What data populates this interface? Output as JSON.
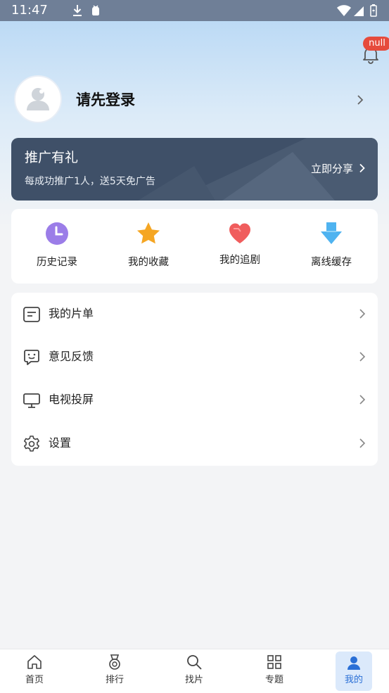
{
  "status_bar": {
    "time": "11:47"
  },
  "notification": {
    "badge": "null"
  },
  "profile": {
    "login_prompt": "请先登录"
  },
  "promo": {
    "title": "推广有礼",
    "subtitle": "每成功推广1人，送5天免广告",
    "action": "立即分享"
  },
  "quick_actions": [
    {
      "label": "历史记录",
      "icon": "clock-icon",
      "color": "#9b7de8"
    },
    {
      "label": "我的收藏",
      "icon": "star-icon",
      "color": "#f5a623"
    },
    {
      "label": "我的追剧",
      "icon": "heart-icon",
      "color": "#f05d5d"
    },
    {
      "label": "离线缓存",
      "icon": "download-arrow-icon",
      "color": "#4fb3f0"
    }
  ],
  "menu": [
    {
      "label": "我的片单",
      "icon": "list-icon"
    },
    {
      "label": "意见反馈",
      "icon": "feedback-icon"
    },
    {
      "label": "电视投屏",
      "icon": "tv-cast-icon"
    },
    {
      "label": "设置",
      "icon": "gear-icon"
    }
  ],
  "tabs": [
    {
      "label": "首页",
      "icon": "home-icon"
    },
    {
      "label": "排行",
      "icon": "medal-icon"
    },
    {
      "label": "找片",
      "icon": "search-icon"
    },
    {
      "label": "专题",
      "icon": "grid-icon"
    },
    {
      "label": "我的",
      "icon": "user-icon",
      "active": true
    }
  ],
  "colors": {
    "accent": "#2a6fd6",
    "promo_bg": "#3f5068",
    "badge": "#e64b3c"
  }
}
